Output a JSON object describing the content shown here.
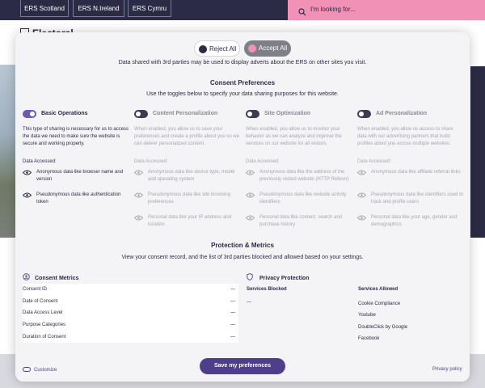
{
  "site": {
    "nav_tabs": [
      "ERS Scotland",
      "ERS N.Ireland",
      "ERS Cymru"
    ],
    "search_placeholder": "I'm looking for...",
    "brand": "Electoral"
  },
  "colors": {
    "navy": "#2b2b45",
    "pink": "#f291b6",
    "purple": "#4f3f8a",
    "toggle_on": "#6b5bb0"
  },
  "consent": {
    "reject_label": "Reject All",
    "accept_label": "Accept All",
    "intro": "Data shared with 3rd parties may be used to display adverts about the ERS on other sites you visit.",
    "preferences_title": "Consent Preferences",
    "preferences_subtitle": "Use the toggles below to specify your data sharing purposes for this website.",
    "data_accessed_label": "Data Accessed:",
    "categories": [
      {
        "title": "Basic Operations",
        "enabled": true,
        "description": "This type of sharing is necessary for us to access the data we need to make sure the website is secure and working properly.",
        "items": [
          "Anonymous data like browser name and version",
          "Pseudonymous data like authentication token"
        ]
      },
      {
        "title": "Content Personalization",
        "enabled": false,
        "description": "When enabled, you allow us to save your preferences and create a profile about you so we can deliver personalized content.",
        "items": [
          "Anonymous data like device type, model and operating system",
          "Pseudonymous data like site browsing preferences",
          "Personal data like your IP address and location"
        ]
      },
      {
        "title": "Site Optimization",
        "enabled": false,
        "description": "When enabled, you allow us to monitor your behavior as we can analyze and improve the services on our website for all visitors.",
        "items": [
          "Anonymous data like the address of the previously visited website (HTTP Referer)",
          "Pseudonymous data like website activity identifiers",
          "Personal data like content, search and purchase history"
        ]
      },
      {
        "title": "Ad Personalization",
        "enabled": false,
        "description": "When enabled, you allow us access to share data with our advertising partners that build profiles about you across multiple websites.",
        "items": [
          "Anonymous data like affiliate referral links",
          "Pseudonymous data like identifiers used to track and profile users",
          "Personal data like your age, gender and demographics"
        ]
      }
    ],
    "protection_title": "Protection & Metrics",
    "protection_subtitle": "View your consent record, and the list of 3rd parties blocked and allowed based on your settings.",
    "metrics_title": "Consent Metrics",
    "metrics": [
      {
        "label": "Consent ID",
        "value": "—"
      },
      {
        "label": "Date of Consent",
        "value": "—"
      },
      {
        "label": "Data Access Level",
        "value": "—"
      },
      {
        "label": "Purpose Categories",
        "value": "—"
      },
      {
        "label": "Duration of Consent",
        "value": "—"
      }
    ],
    "privacy_title": "Privacy Protection",
    "blocked_title": "Services Blocked",
    "blocked_value": "—",
    "allowed_title": "Services Allowed",
    "allowed": [
      "Cookie Compliance",
      "Youtube",
      "DoubleClick by Google",
      "Facebook"
    ],
    "save_label": "Save my preferences",
    "customize_label": "Customize",
    "privacy_policy_label": "Privacy policy"
  }
}
